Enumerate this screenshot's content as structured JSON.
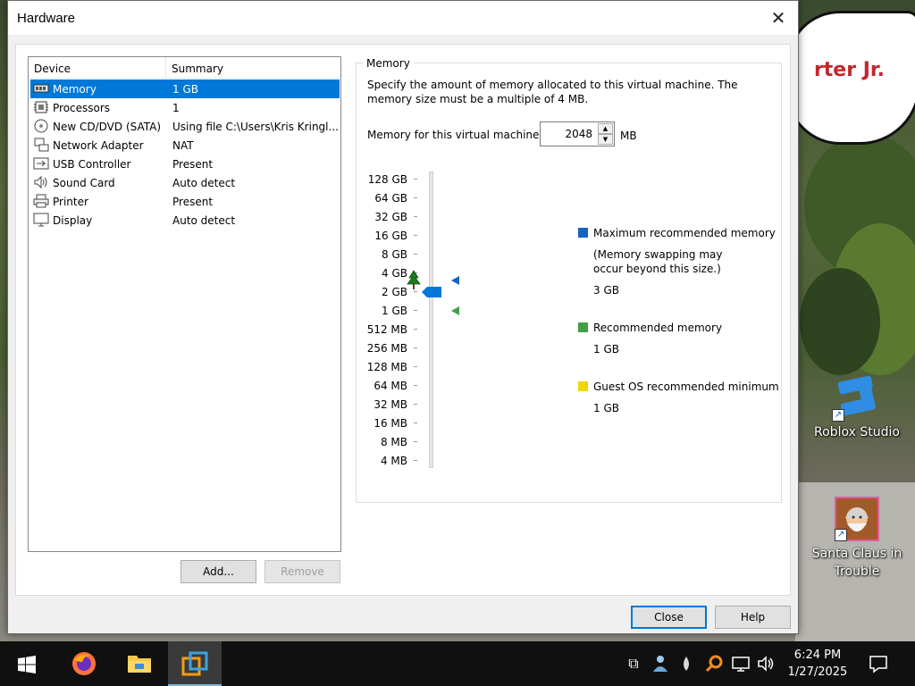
{
  "dialog": {
    "title": "Hardware",
    "close_glyph": "✕"
  },
  "device_list": {
    "columns": [
      "Device",
      "Summary"
    ],
    "rows": [
      {
        "icon": "memory-icon",
        "name": "Memory",
        "summary": "1 GB",
        "selected": true
      },
      {
        "icon": "processor-icon",
        "name": "Processors",
        "summary": "1"
      },
      {
        "icon": "cd-dvd-icon",
        "name": "New CD/DVD (SATA)",
        "summary": "Using file C:\\Users\\Kris Kringl..."
      },
      {
        "icon": "network-adapter-icon",
        "name": "Network Adapter",
        "summary": "NAT"
      },
      {
        "icon": "usb-icon",
        "name": "USB Controller",
        "summary": "Present"
      },
      {
        "icon": "sound-card-icon",
        "name": "Sound Card",
        "summary": "Auto detect"
      },
      {
        "icon": "printer-icon",
        "name": "Printer",
        "summary": "Present"
      },
      {
        "icon": "display-icon",
        "name": "Display",
        "summary": "Auto detect"
      }
    ],
    "add_label": "Add...",
    "remove_label": "Remove"
  },
  "memory": {
    "group_title": "Memory",
    "description": "Specify the amount of memory allocated to this virtual machine. The memory size must be a multiple of 4 MB.",
    "field_label": "Memory for this virtual machine:",
    "value": "2048",
    "unit": "MB",
    "scale_labels": [
      "128 GB",
      "64 GB",
      "32 GB",
      "16 GB",
      "8 GB",
      "4 GB",
      "2 GB",
      "1 GB",
      "512 MB",
      "256 MB",
      "128 MB",
      "64 MB",
      "32 MB",
      "16 MB",
      "8 MB",
      "4 MB"
    ],
    "legend": {
      "max": {
        "title": "Maximum recommended memory",
        "note": "(Memory swapping may occur beyond this size.)",
        "value": "3 GB",
        "color": "#1565c0"
      },
      "recommended": {
        "title": "Recommended memory",
        "value": "1 GB",
        "color": "#43a047"
      },
      "guest_min": {
        "title": "Guest OS recommended minimum",
        "value": "1 GB",
        "color": "#f2d600"
      }
    }
  },
  "footer": {
    "close_label": "Close",
    "help_label": "Help"
  },
  "desktop": {
    "speech_text": "rter Jr.",
    "icons": [
      {
        "label": "Roblox Studio",
        "icon": "roblox-studio-icon"
      },
      {
        "label": "Santa Claus in Trouble",
        "icon": "santa-claus-game-icon"
      }
    ]
  },
  "taskbar": {
    "time": "6:24 PM",
    "date": "1/27/2025"
  }
}
